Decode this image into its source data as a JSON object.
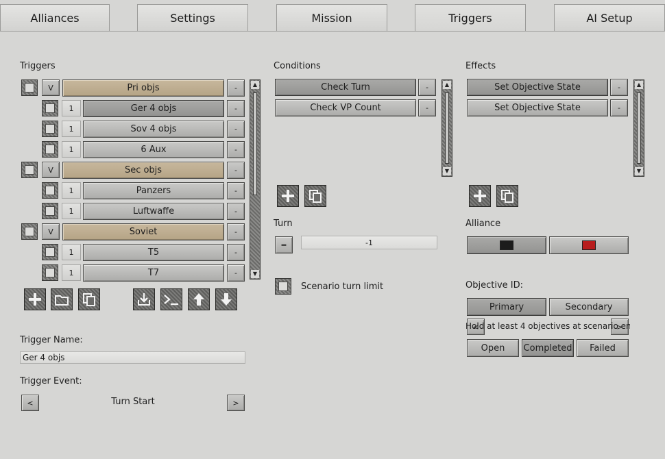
{
  "tabs": [
    {
      "label": "Alliances"
    },
    {
      "label": "Settings"
    },
    {
      "label": "Mission"
    },
    {
      "label": "Triggers"
    },
    {
      "label": "AI Setup"
    }
  ],
  "triggers": {
    "heading": "Triggers",
    "items": [
      {
        "type": "group",
        "toggle": "V",
        "label": "Pri objs"
      },
      {
        "type": "item",
        "count": "1",
        "label": "Ger 4 objs"
      },
      {
        "type": "item",
        "count": "1",
        "label": "Sov 4 objs"
      },
      {
        "type": "item",
        "count": "1",
        "label": "6 Aux"
      },
      {
        "type": "group",
        "toggle": "V",
        "label": "Sec objs"
      },
      {
        "type": "item",
        "count": "1",
        "label": "Panzers"
      },
      {
        "type": "item",
        "count": "1",
        "label": "Luftwaffe"
      },
      {
        "type": "group",
        "toggle": "V",
        "label": "Soviet"
      },
      {
        "type": "item",
        "count": "1",
        "label": "T5"
      },
      {
        "type": "item",
        "count": "1",
        "label": "T7"
      }
    ],
    "remove_label": "-",
    "name_label": "Trigger Name:",
    "name_value": "Ger 4 objs",
    "event_label": "Trigger Event:",
    "event_value": "Turn Start",
    "prev": "<",
    "next": ">"
  },
  "conditions": {
    "heading": "Conditions",
    "items": [
      "Check Turn",
      "Check VP Count"
    ],
    "remove_label": "-",
    "turn_label": "Turn",
    "turn_operator": "=",
    "turn_value": "-1",
    "turn_limit_label": "Scenario turn limit"
  },
  "effects": {
    "heading": "Effects",
    "items": [
      "Set Objective State",
      "Set Objective State"
    ],
    "remove_label": "-",
    "alliance_label": "Alliance",
    "alliance_colors": [
      "#1c1c1c",
      "#b81d1d"
    ],
    "objective_label": "Objective ID:",
    "primary": "Primary",
    "secondary": "Secondary",
    "objective_text": "Hold at least 4 objectives at scenario end",
    "prev": "<",
    "next": ">",
    "states": [
      "Open",
      "Completed",
      "Failed"
    ]
  }
}
